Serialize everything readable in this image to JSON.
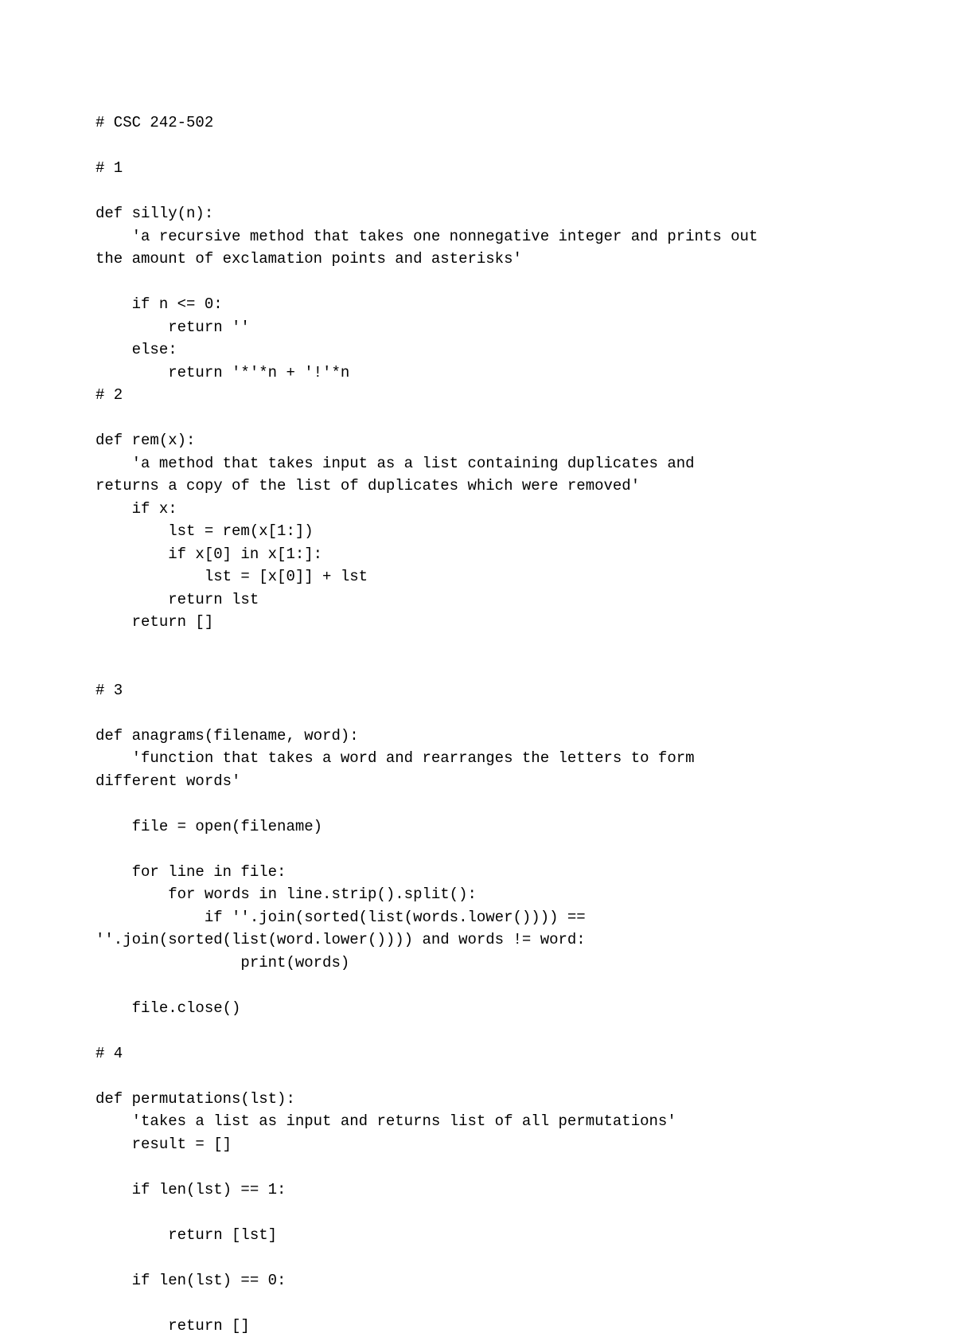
{
  "code": {
    "lines": [
      "# CSC 242-502",
      "",
      "# 1",
      "",
      "def silly(n):",
      "    'a recursive method that takes one nonnegative integer and prints out",
      "the amount of exclamation points and asterisks'",
      "",
      "    if n <= 0:",
      "        return ''",
      "    else:",
      "        return '*'*n + '!'*n",
      "# 2",
      "",
      "def rem(x):",
      "    'a method that takes input as a list containing duplicates and",
      "returns a copy of the list of duplicates which were removed'",
      "    if x:",
      "        lst = rem(x[1:])",
      "        if x[0] in x[1:]:",
      "            lst = [x[0]] + lst",
      "        return lst",
      "    return []",
      "",
      "",
      "# 3",
      "",
      "def anagrams(filename, word):",
      "    'function that takes a word and rearranges the letters to form",
      "different words'",
      "",
      "    file = open(filename)",
      "",
      "    for line in file:",
      "        for words in line.strip().split():",
      "            if ''.join(sorted(list(words.lower()))) ==",
      "''.join(sorted(list(word.lower()))) and words != word:",
      "                print(words)",
      "",
      "    file.close()",
      "",
      "# 4",
      "",
      "def permutations(lst):",
      "    'takes a list as input and returns list of all permutations'",
      "    result = []",
      "",
      "    if len(lst) == 1:",
      "",
      "        return [lst]",
      "",
      "    if len(lst) == 0:",
      "",
      "        return []"
    ]
  }
}
